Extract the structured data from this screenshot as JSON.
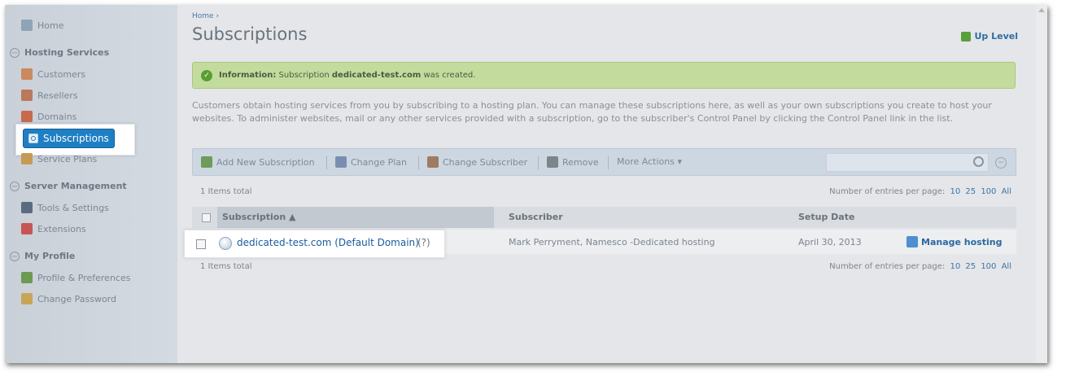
{
  "sidebar": {
    "home": "Home",
    "hosting_services": {
      "label": "Hosting Services",
      "items": [
        "Customers",
        "Resellers",
        "Domains",
        "Subscriptions",
        "Service Plans"
      ]
    },
    "server_management": {
      "label": "Server Management",
      "items": [
        "Tools & Settings",
        "Extensions"
      ]
    },
    "my_profile": {
      "label": "My Profile",
      "items": [
        "Profile & Preferences",
        "Change Password"
      ]
    }
  },
  "header": {
    "breadcrumb": "Home ›",
    "title": "Subscriptions",
    "up_level": "Up Level"
  },
  "info": {
    "label": "Information:",
    "text_before": "Subscription",
    "subscription": "dedicated-test.com",
    "text_after": "was created."
  },
  "description": "Customers obtain hosting services from you by subscribing to a hosting plan. You can manage these subscriptions here, as well as your own subscriptions you create to host your websites. To administer websites, mail or any other services provided with a subscription, go to the subscriber's Control Panel by clicking the Control Panel link in the list.",
  "toolbar": {
    "add": "Add New Subscription",
    "change_plan": "Change Plan",
    "change_subscriber": "Change Subscriber",
    "remove": "Remove",
    "more_actions": "More Actions ▾",
    "search_value": ""
  },
  "list": {
    "total": "1 Items total",
    "per_page_label": "Number of entries per page:",
    "per_page_options": [
      "10",
      "25",
      "100",
      "All"
    ],
    "columns": {
      "subscription": "Subscription ▲",
      "subscriber": "Subscriber",
      "setup_date": "Setup Date"
    },
    "rows": [
      {
        "subscription": "dedicated-test.com (Default Domain)",
        "help": "(?)",
        "subscriber": "Mark Perryment, Namesco -Dedicated hosting",
        "setup_date": "April 30, 2013",
        "action": "Manage hosting"
      }
    ]
  },
  "colors": {
    "selected_nav": "#1f7fc4",
    "info_bg": "#c3dc9d",
    "link": "#1a5c9c"
  }
}
